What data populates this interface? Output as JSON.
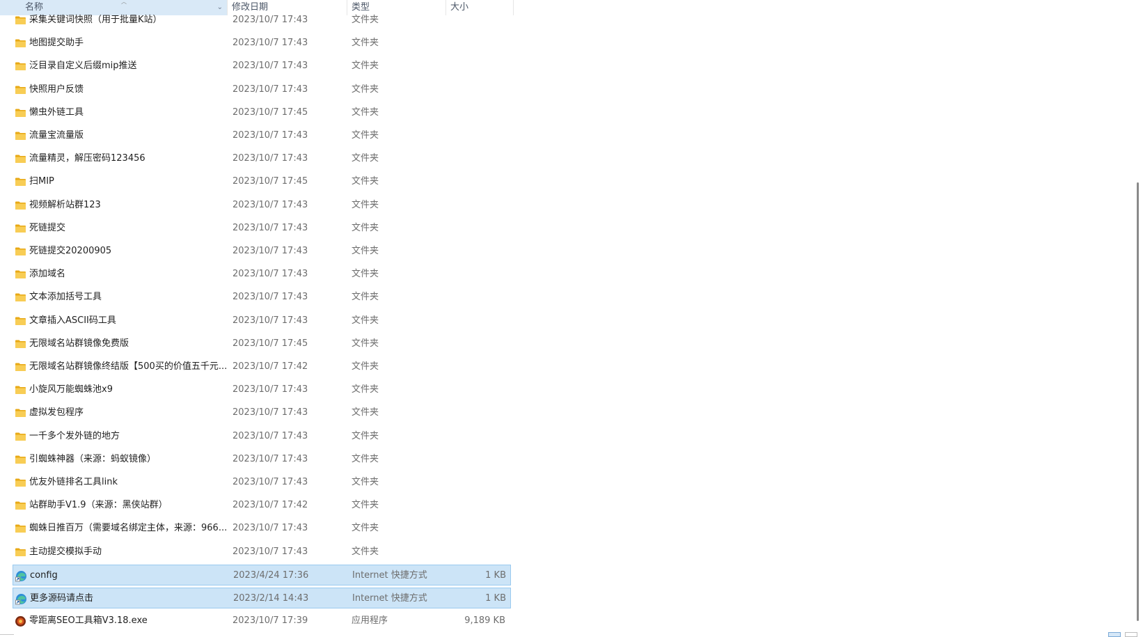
{
  "columns": {
    "name": "名称",
    "date": "修改日期",
    "type": "类型",
    "size": "大小"
  },
  "icons": {
    "folder": "folder-icon",
    "shortcut": "edge-shortcut-icon",
    "exe": "app-exe-icon"
  },
  "colors": {
    "selection": "#cce4f7",
    "selection_border": "#99c9ef",
    "header_active": "#d9e9f7",
    "folder": "#f6c34a"
  },
  "files": [
    {
      "name": "采集关键词快照（用于批量K站）",
      "date": "2023/10/7 17:43",
      "type": "文件夹",
      "size": "",
      "kind": "folder",
      "selected": false
    },
    {
      "name": "地图提交助手",
      "date": "2023/10/7 17:43",
      "type": "文件夹",
      "size": "",
      "kind": "folder",
      "selected": false
    },
    {
      "name": "泛目录自定义后缀mip推送",
      "date": "2023/10/7 17:43",
      "type": "文件夹",
      "size": "",
      "kind": "folder",
      "selected": false
    },
    {
      "name": "快照用户反馈",
      "date": "2023/10/7 17:43",
      "type": "文件夹",
      "size": "",
      "kind": "folder",
      "selected": false
    },
    {
      "name": "懒虫外链工具",
      "date": "2023/10/7 17:45",
      "type": "文件夹",
      "size": "",
      "kind": "folder",
      "selected": false
    },
    {
      "name": "流量宝流量版",
      "date": "2023/10/7 17:43",
      "type": "文件夹",
      "size": "",
      "kind": "folder",
      "selected": false
    },
    {
      "name": "流量精灵，解压密码123456",
      "date": "2023/10/7 17:43",
      "type": "文件夹",
      "size": "",
      "kind": "folder",
      "selected": false
    },
    {
      "name": "扫MIP",
      "date": "2023/10/7 17:45",
      "type": "文件夹",
      "size": "",
      "kind": "folder",
      "selected": false
    },
    {
      "name": "视频解析站群123",
      "date": "2023/10/7 17:43",
      "type": "文件夹",
      "size": "",
      "kind": "folder",
      "selected": false
    },
    {
      "name": "死链提交",
      "date": "2023/10/7 17:43",
      "type": "文件夹",
      "size": "",
      "kind": "folder",
      "selected": false
    },
    {
      "name": "死链提交20200905",
      "date": "2023/10/7 17:43",
      "type": "文件夹",
      "size": "",
      "kind": "folder",
      "selected": false
    },
    {
      "name": "添加域名",
      "date": "2023/10/7 17:43",
      "type": "文件夹",
      "size": "",
      "kind": "folder",
      "selected": false
    },
    {
      "name": "文本添加括号工具",
      "date": "2023/10/7 17:43",
      "type": "文件夹",
      "size": "",
      "kind": "folder",
      "selected": false
    },
    {
      "name": "文章插入ASCII码工具",
      "date": "2023/10/7 17:43",
      "type": "文件夹",
      "size": "",
      "kind": "folder",
      "selected": false
    },
    {
      "name": "无限域名站群镜像免费版",
      "date": "2023/10/7 17:45",
      "type": "文件夹",
      "size": "",
      "kind": "folder",
      "selected": false
    },
    {
      "name": "无限域名站群镜像终结版【500买的价值五千元...",
      "date": "2023/10/7 17:42",
      "type": "文件夹",
      "size": "",
      "kind": "folder",
      "selected": false
    },
    {
      "name": "小旋风万能蜘蛛池x9",
      "date": "2023/10/7 17:43",
      "type": "文件夹",
      "size": "",
      "kind": "folder",
      "selected": false
    },
    {
      "name": "虚拟发包程序",
      "date": "2023/10/7 17:43",
      "type": "文件夹",
      "size": "",
      "kind": "folder",
      "selected": false
    },
    {
      "name": "一千多个发外链的地方",
      "date": "2023/10/7 17:43",
      "type": "文件夹",
      "size": "",
      "kind": "folder",
      "selected": false
    },
    {
      "name": "引蜘蛛神器（来源：蚂蚁镜像）",
      "date": "2023/10/7 17:43",
      "type": "文件夹",
      "size": "",
      "kind": "folder",
      "selected": false
    },
    {
      "name": "优友外链排名工具link",
      "date": "2023/10/7 17:43",
      "type": "文件夹",
      "size": "",
      "kind": "folder",
      "selected": false
    },
    {
      "name": "站群助手V1.9（来源：黑侠站群）",
      "date": "2023/10/7 17:42",
      "type": "文件夹",
      "size": "",
      "kind": "folder",
      "selected": false
    },
    {
      "name": "蜘蛛日推百万（需要域名绑定主体，来源：966...",
      "date": "2023/10/7 17:43",
      "type": "文件夹",
      "size": "",
      "kind": "folder",
      "selected": false
    },
    {
      "name": "主动提交模拟手动",
      "date": "2023/10/7 17:43",
      "type": "文件夹",
      "size": "",
      "kind": "folder",
      "selected": false
    },
    {
      "name": "config",
      "date": "2023/4/24 17:36",
      "type": "Internet 快捷方式",
      "size": "1 KB",
      "kind": "shortcut",
      "selected": true
    },
    {
      "name": "更多源码请点击",
      "date": "2023/2/14 14:43",
      "type": "Internet 快捷方式",
      "size": "1 KB",
      "kind": "shortcut",
      "selected": true
    },
    {
      "name": "零距离SEO工具箱V3.18.exe",
      "date": "2023/10/7 17:39",
      "type": "应用程序",
      "size": "9,189 KB",
      "kind": "exe",
      "selected": false
    }
  ]
}
